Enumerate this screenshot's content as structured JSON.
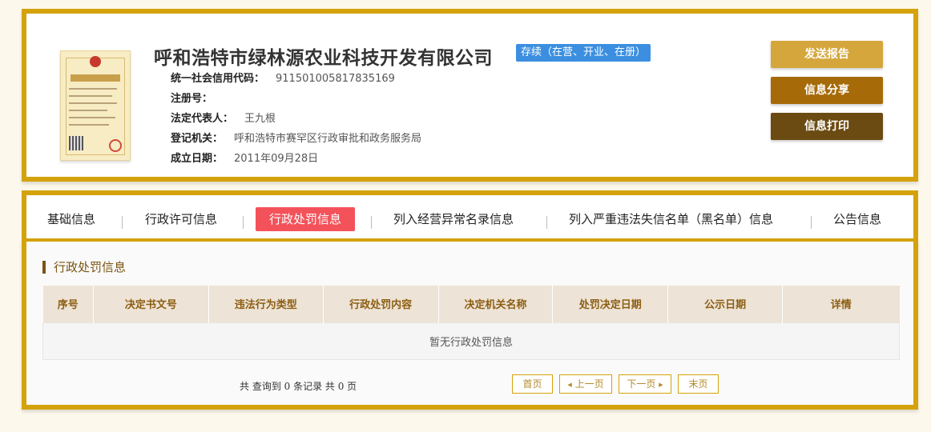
{
  "company": {
    "name": "呼和浩特市绿林源农业科技开发有限公司",
    "status": "存续（在营、开业、在册）",
    "fields": [
      {
        "label": "统一社会信用代码：",
        "value": "911501005817835169"
      },
      {
        "label": "注册号：",
        "value": ""
      },
      {
        "label": "法定代表人：",
        "value": "王九根"
      },
      {
        "label": "登记机关：",
        "value": "呼和浩特市赛罕区行政审批和政务服务局"
      },
      {
        "label": "成立日期：",
        "value": "2011年09月28日"
      }
    ]
  },
  "actions": {
    "report": "发送报告",
    "share": "信息分享",
    "print": "信息打印"
  },
  "tabs": [
    {
      "label": "基础信息",
      "active": false
    },
    {
      "label": "行政许可信息",
      "active": false
    },
    {
      "label": "行政处罚信息",
      "active": true
    },
    {
      "label": "列入经营异常名录信息",
      "active": false
    },
    {
      "label": "列入严重违法失信名单（黑名单）信息",
      "active": false
    },
    {
      "label": "公告信息",
      "active": false
    }
  ],
  "section": {
    "title": "行政处罚信息",
    "columns": [
      "序号",
      "决定书文号",
      "违法行为类型",
      "行政处罚内容",
      "决定机关名称",
      "处罚决定日期",
      "公示日期",
      "详情"
    ],
    "empty_text": "暂无行政处罚信息"
  },
  "pager": {
    "summary": "共 查询到 0 条记录 共 0 页",
    "first": "首页",
    "prev": "上一页",
    "next": "下一页",
    "last": "末页"
  },
  "colors": {
    "accent": "#d4a20b",
    "tab_active": "#f4525a",
    "status_badge": "#3c8fe0"
  }
}
